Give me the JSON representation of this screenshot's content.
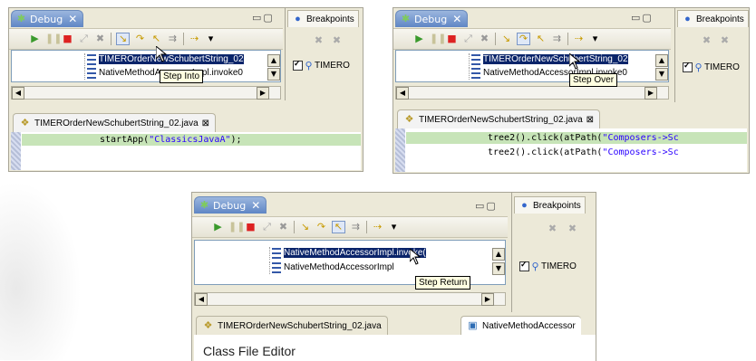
{
  "panel1": {
    "debug_tab": "Debug",
    "close": "✕",
    "minmax": "▭▢",
    "rows": [
      "TIMEROrderNewSchubertString_02",
      "NativeMethodAccessorImpl.invoke0"
    ],
    "tooltip": "Step Into",
    "breakpoints": "Breakpoints",
    "bp_entry": "TIMERO",
    "editor_tab": "TIMEROrderNewSchubertString_02.java",
    "editor_close": "⊠",
    "code_lines": [
      "startApp(\"ClassicsJavaA\");"
    ]
  },
  "panel2": {
    "debug_tab": "Debug",
    "close": "✕",
    "minmax": "▭▢",
    "rows": [
      "TIMEROrderNewSchubertString_02",
      "NativeMethodAccessorImpl.invoke0"
    ],
    "tooltip": "Step Over",
    "breakpoints": "Breakpoints",
    "bp_entry": "TIMERO",
    "editor_tab": "TIMEROrderNewSchubertString_02.java",
    "editor_close": "⊠",
    "code_lines": [
      "tree2().click(atPath(\"Composers->Sc",
      "tree2().click(atPath(\"Composers->Sc"
    ]
  },
  "panel3": {
    "debug_tab": "Debug",
    "close": "✕",
    "minmax": "▭▢",
    "rows": [
      "NativeMethodAccessorImpl.invoke(",
      "NativeMethodAccessorImpl"
    ],
    "tooltip": "Step Return",
    "breakpoints": "Breakpoints",
    "bp_entry": "TIMERO",
    "editor_tab": "TIMEROrderNewSchubertString_02.java",
    "editor_tab2": "NativeMethodAccessor",
    "class_file_editor": "Class File Editor"
  },
  "icons": [
    "resume-icon",
    "suspend-icon",
    "terminate-icon",
    "disconnect-icon",
    "remove-terminated-icon",
    "step-into-icon",
    "step-over-icon",
    "step-return-icon",
    "drop-to-frame-icon",
    "use-step-filters-icon",
    "menu-icon"
  ],
  "colors": {
    "tab_blue": "#5f86c5",
    "selection": "#0a246a",
    "highlight": "#c7e4b8",
    "tooltip_bg": "#ffffe1",
    "string_blue": "#2a00ff"
  }
}
